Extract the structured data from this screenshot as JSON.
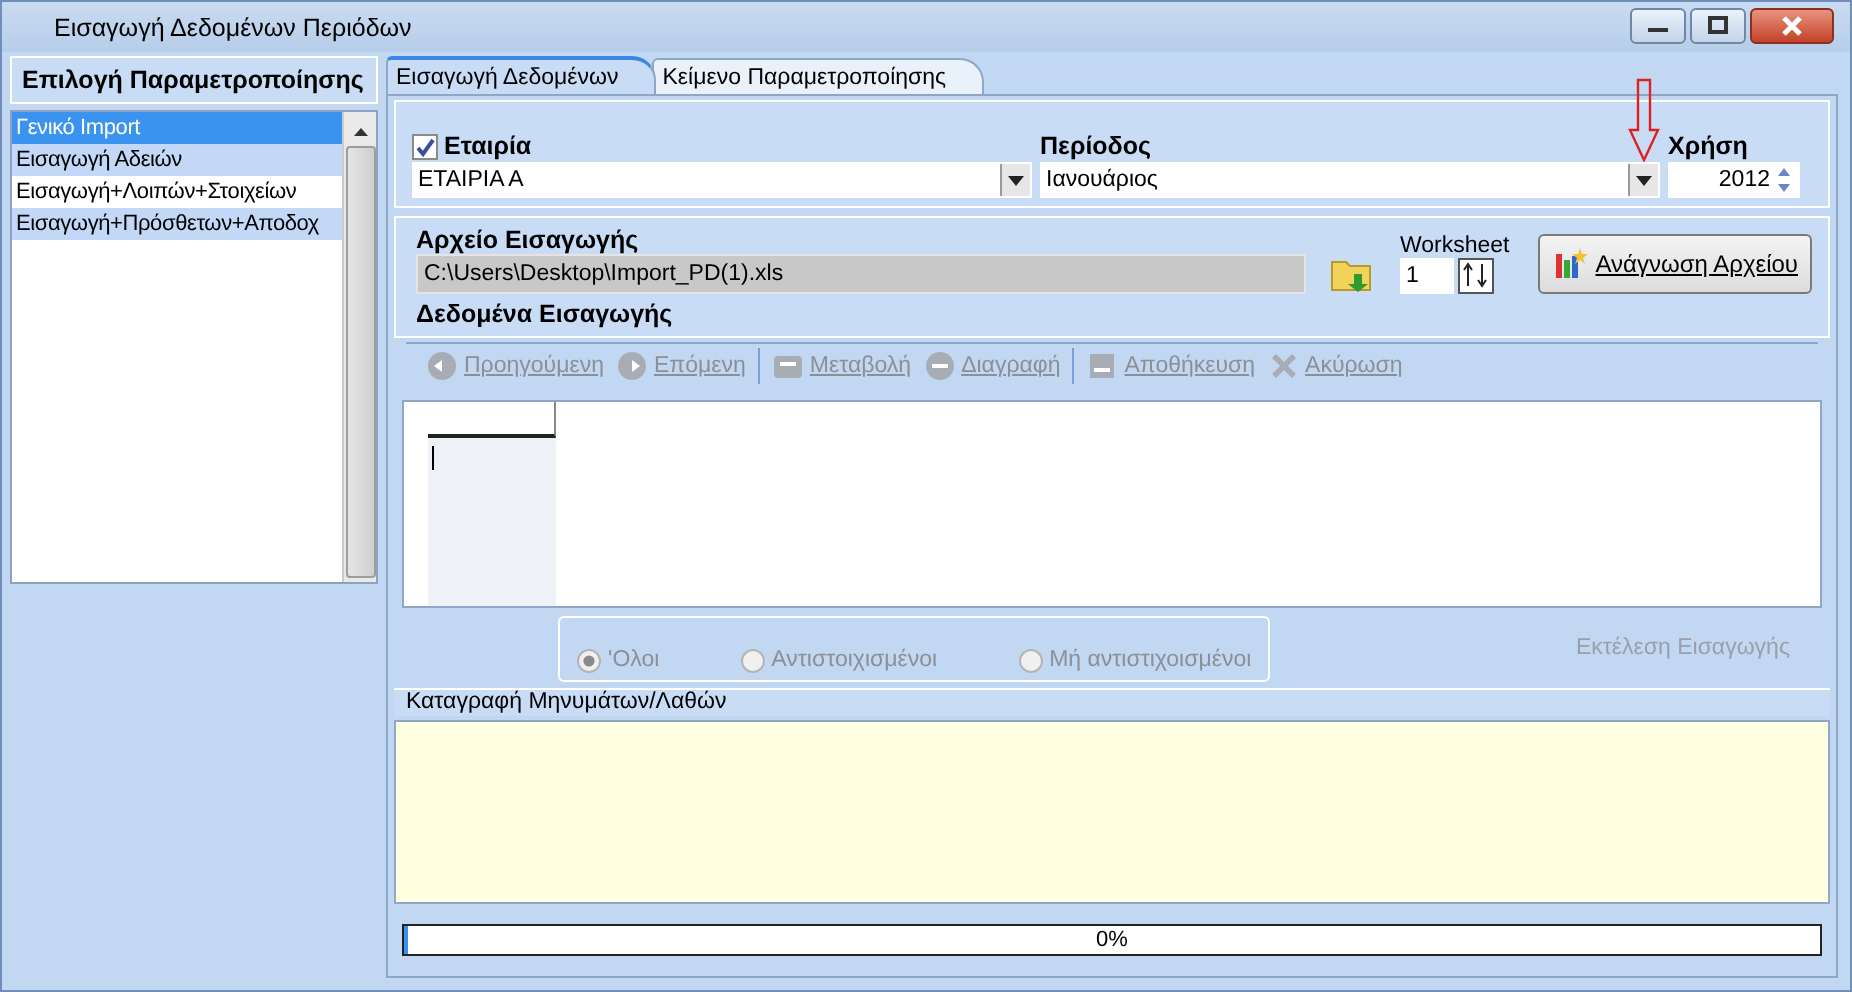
{
  "window": {
    "title": "Εισαγωγή Δεδομένων Περιόδων"
  },
  "sidebar": {
    "title": "Επιλογή Παραμετροποίησης",
    "items": [
      {
        "label": "Γενικό Import",
        "selected": true
      },
      {
        "label": "Εισαγωγή Αδειών",
        "selected": false
      },
      {
        "label": "Εισαγωγή+Λοιπών+Στοιχείων",
        "selected": false
      },
      {
        "label": "Εισαγωγή+Πρόσθετων+Αποδοχ",
        "selected": false
      }
    ]
  },
  "tabs": [
    {
      "label": "Εισαγωγή Δεδομένων",
      "selected": true
    },
    {
      "label": "Κείμενο Παραμετροποίησης",
      "selected": false
    }
  ],
  "company": {
    "label": "Εταιρία",
    "checked": true,
    "value": "ΕΤΑΙΡΙΑ Α"
  },
  "period": {
    "label": "Περίοδος",
    "value": "Ιανουάριος"
  },
  "year": {
    "label": "Χρήση",
    "value": "2012"
  },
  "file": {
    "label": "Αρχείο Εισαγωγής",
    "path": "C:\\Users\\Desktop\\Import_PD(1).xls"
  },
  "worksheet": {
    "label": "Worksheet",
    "value": "1"
  },
  "read_button": {
    "label": "Ανάγνωση Αρχείου"
  },
  "data_label": "Δεδομένα Εισαγωγής",
  "toolbar": [
    {
      "kind": "prev",
      "label": "Προηγούμενη",
      "disabled": true
    },
    {
      "kind": "next",
      "label": "Επόμενη",
      "disabled": true
    },
    {
      "kind": "edit",
      "label": "Μεταβολή",
      "disabled": true
    },
    {
      "kind": "delete",
      "label": "Διαγραφή",
      "disabled": true
    },
    {
      "kind": "save",
      "label": "Αποθήκευση",
      "disabled": true
    },
    {
      "kind": "cancel",
      "label": "Ακύρωση",
      "disabled": true
    }
  ],
  "radios": [
    {
      "label": "'Ολοι",
      "selected": true,
      "disabled": true
    },
    {
      "label": "Αντιστοιχισμένοι",
      "selected": false,
      "disabled": true
    },
    {
      "label": "Μή αντιστιχοισμένοι",
      "selected": false,
      "disabled": true
    }
  ],
  "execute": {
    "label": "Εκτέλεση Εισαγωγής",
    "disabled": true
  },
  "log": {
    "title": "Καταγραφή Μηνυμάτων/Λαθών"
  },
  "progress": {
    "level": 0,
    "text": "0%"
  }
}
